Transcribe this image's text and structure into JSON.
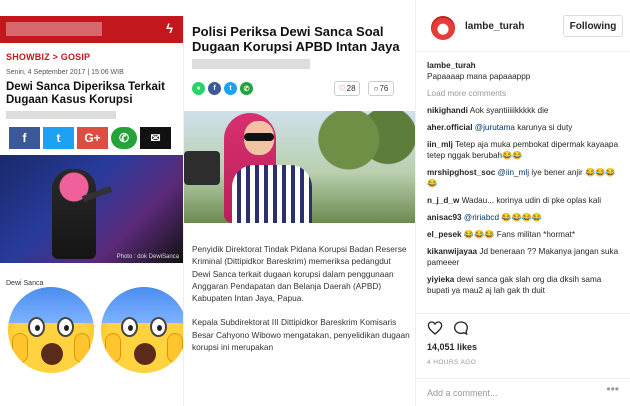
{
  "post": {
    "article1": {
      "category": "SHOWBIZ > GOSIP",
      "date": "Senin, 4 September 2017 | 15:06 WIB",
      "title": "Dewi Sanca Diperiksa Terkait Dugaan Kasus Korupsi",
      "share_labels": [
        "f",
        "t",
        "G+",
        "✆",
        "✉"
      ],
      "photo_credit": "Photo : dok DewiSanca",
      "caption": "Dewi Sanca"
    },
    "article2": {
      "title": "Polisi Periksa Dewi Sanca Soal Dugaan Korupsi APBD Intan Jaya",
      "likes": "28",
      "comments": "76",
      "paragraph1": "Penyidik Direktorat Tindak Pidana Korupsi Badan Reserse Kriminal (Dittipidkor Bareskrim) memeriksa pedangdut Dewi Sanca terkait dugaan korupsi dalam penggunaan Anggaran Pendapatan dan Belanja Daerah (APBD) Kabupaten Intan Jaya, Papua.",
      "paragraph2": "Kepala Subdirektorat III Dittipidkor Bareskrim Komisaris Besar Cahyono Wibowo mengatakan, penyelidikan dugaan korupsi ini merupakan"
    }
  },
  "panel": {
    "username": "lambe_turah",
    "follow_label": "Following",
    "caption_user": "lambe_turah",
    "caption_text": "Papaaaap mana papaaappp",
    "load_more": "Load more comments",
    "comments": [
      {
        "user": "nikighandi",
        "text": "Aok syantiiiiikkkkk die"
      },
      {
        "user": "aher.official",
        "mention": "@jurutama",
        "text": " karunya si duty"
      },
      {
        "user": "iin_mlj",
        "text": "Tetep aja muka pembokat dipermak kayaapa tetep nggak berubah😂😂"
      },
      {
        "user": "mrshipghost_soc",
        "mention": "@iin_mlj",
        "text": " iye bener anjir 😂😂😂😂"
      },
      {
        "user": "n_j_d_w",
        "text": "Wadau... korinya udin di pke oplas kali"
      },
      {
        "user": "anisac93",
        "mention": "@ririabcd",
        "text": " 😂😂😂😂"
      },
      {
        "user": "el_pesek",
        "text": "😂😂😂 Fans militan *hormat*"
      },
      {
        "user": "kikanwijayaa",
        "text": "Jd beneraan ?? Makanya jangan suka pameeer"
      },
      {
        "user": "yiyieka",
        "text": "dewi sanca gak slah org dia dksih sama bupati ya mau2 aj lah gak th duit"
      }
    ],
    "likes": "14,051 likes",
    "time": "4 HOURS AGO",
    "comment_placeholder": "Add a comment...",
    "more_label": "•••"
  }
}
